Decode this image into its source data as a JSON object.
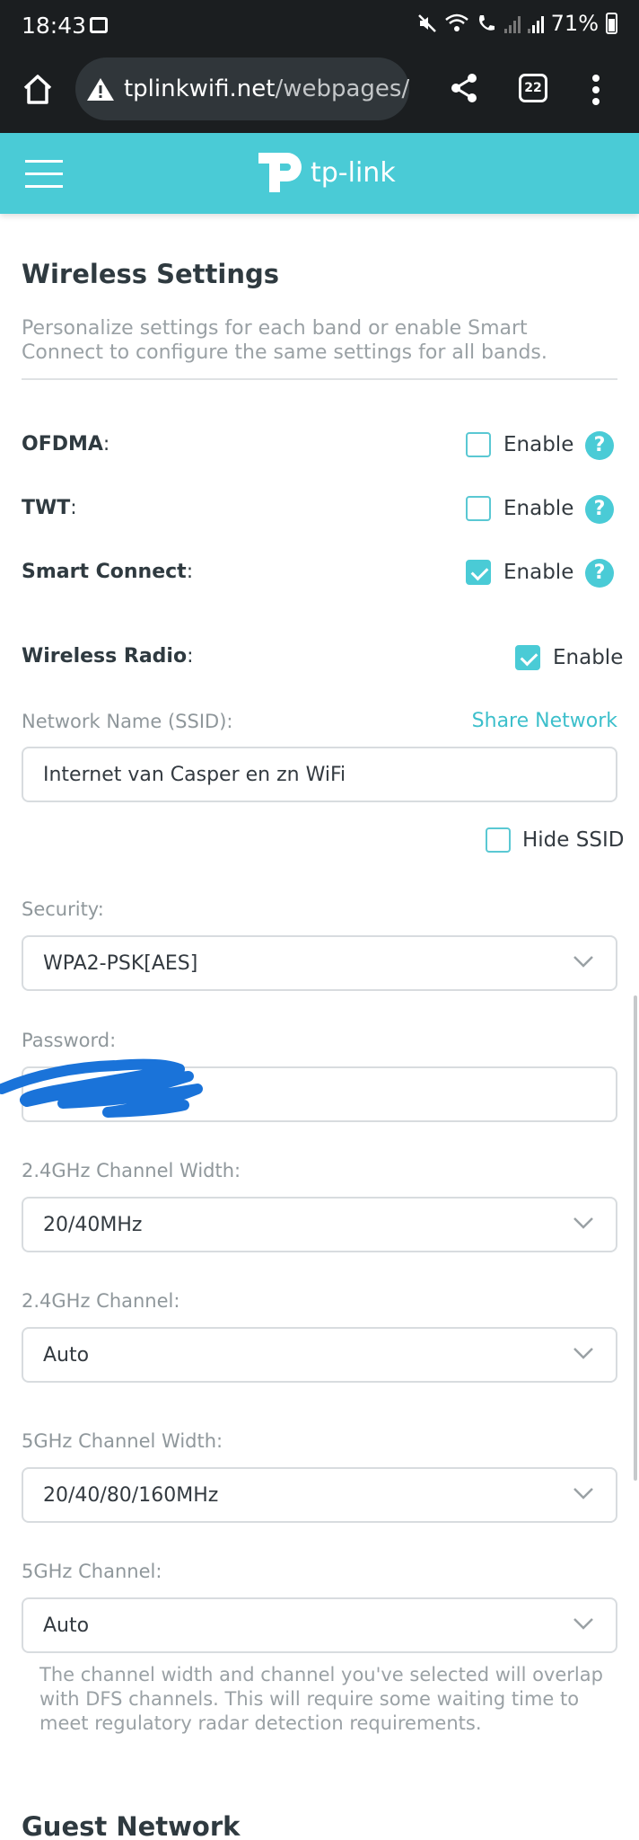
{
  "status_bar": {
    "time": "18:43",
    "battery": "71%"
  },
  "browser": {
    "url_domain": "tplinkwifi.net",
    "url_path": "/webpages/",
    "tab_count": "22"
  },
  "header": {
    "logo_text": "tp-link"
  },
  "wireless": {
    "title": "Wireless Settings",
    "description": "Personalize settings for each band or enable Smart Connect to configure the same settings for all bands.",
    "ofdma": {
      "label": "OFDMA",
      "suffix": ":",
      "option": "Enable",
      "checked": false
    },
    "twt": {
      "label": "TWT",
      "suffix": ":",
      "option": "Enable",
      "checked": false
    },
    "smart_connect": {
      "label": "Smart Connect",
      "suffix": ":",
      "option": "Enable",
      "checked": true
    },
    "wireless_radio": {
      "label": "Wireless Radio",
      "suffix": ":",
      "option": "Enable",
      "checked": true
    },
    "ssid": {
      "label": "Network Name (SSID):",
      "share_link": "Share Network",
      "value": "Internet van Casper en zn WiFi"
    },
    "hide_ssid": {
      "label": "Hide SSID",
      "checked": false
    },
    "security": {
      "label": "Security:",
      "value": "WPA2-PSK[AES]"
    },
    "password": {
      "label": "Password:",
      "value": ""
    },
    "ch_width_24": {
      "label": "2.4GHz Channel Width:",
      "value": "20/40MHz"
    },
    "channel_24": {
      "label": "2.4GHz Channel:",
      "value": "Auto"
    },
    "ch_width_5": {
      "label": "5GHz Channel Width:",
      "value": "20/40/80/160MHz"
    },
    "channel_5": {
      "label": "5GHz Channel:",
      "value": "Auto"
    },
    "dfs_note": "The channel width and channel you've selected will overlap with DFS channels. This will require some waiting time to meet regulatory radar detection requirements."
  },
  "guest": {
    "title": "Guest Network"
  },
  "colors": {
    "accent": "#4acbd6",
    "link": "#3cbfcb",
    "scribble": "#1a73d9"
  }
}
